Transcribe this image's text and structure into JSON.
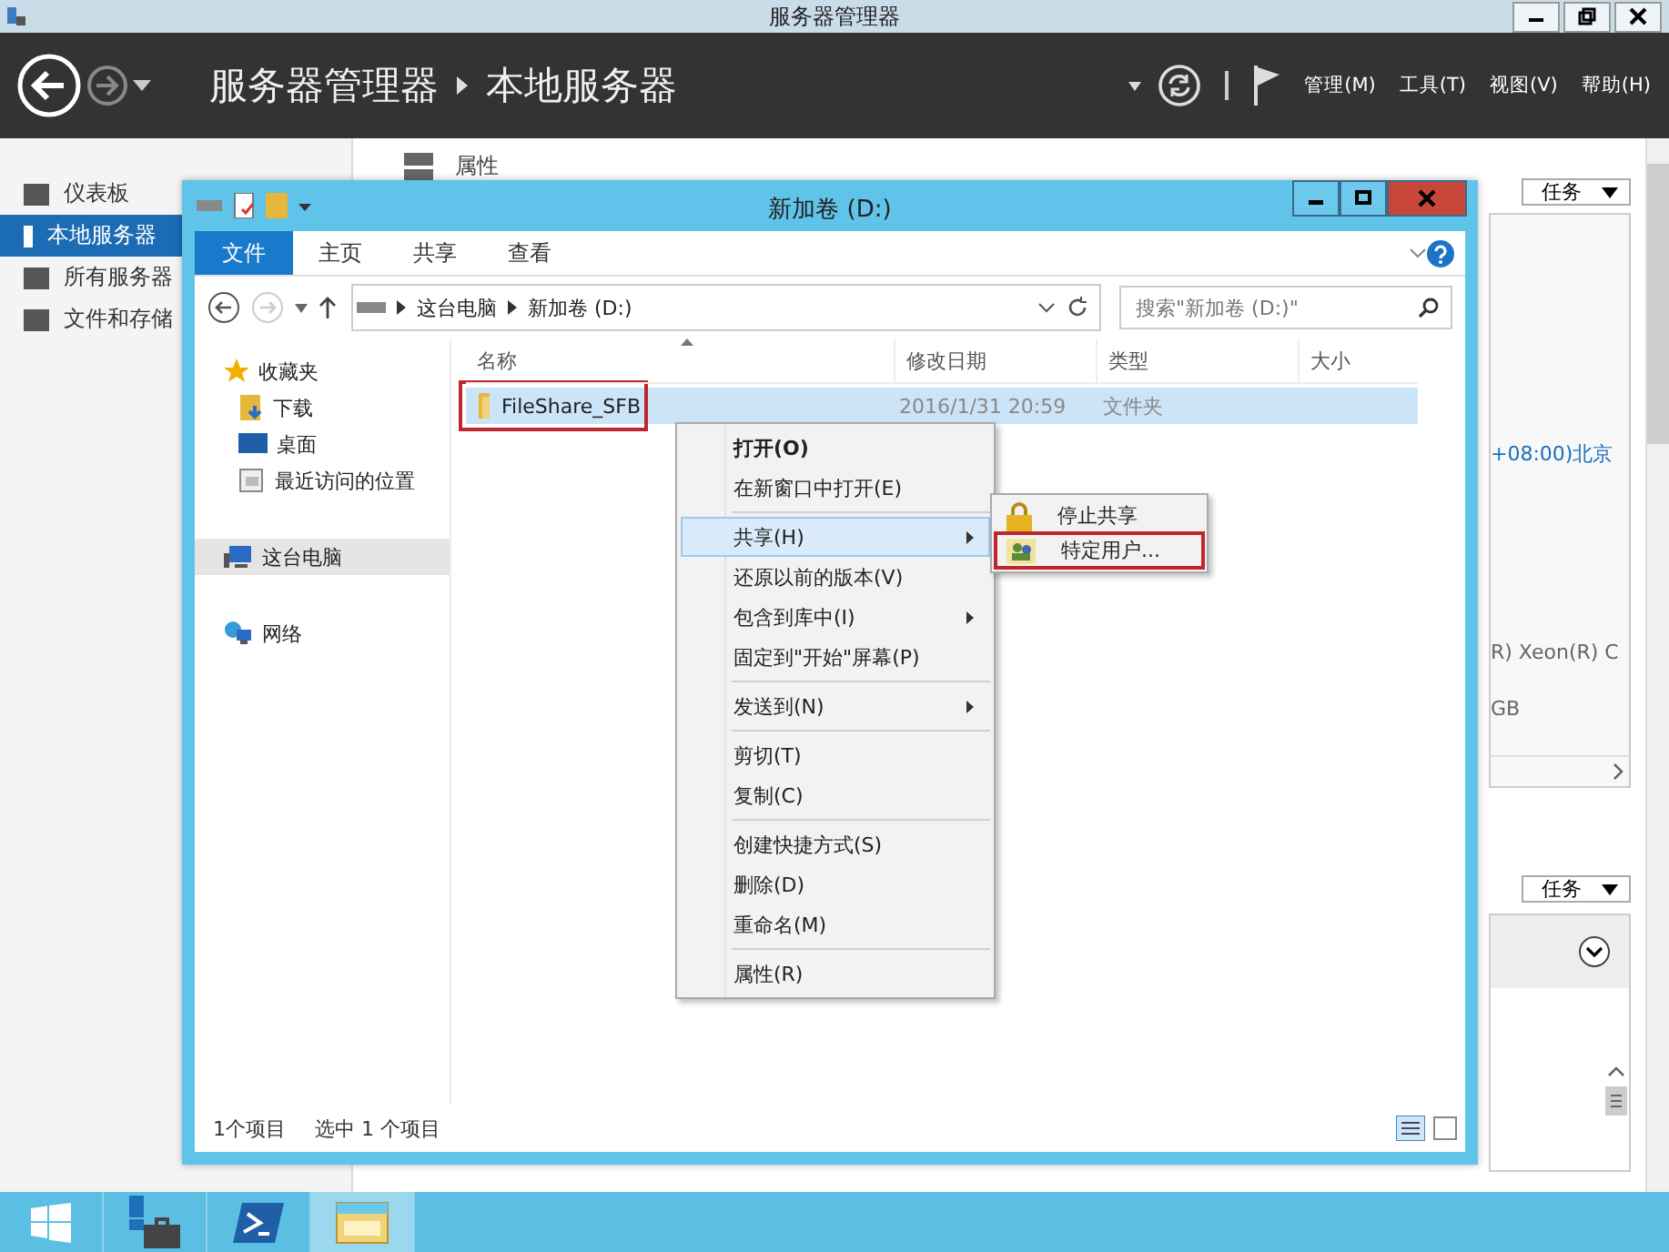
{
  "title_bar": {
    "title": "服务器管理器"
  },
  "header": {
    "breadcrumb": [
      "服务器管理器",
      "本地服务器"
    ],
    "menu": [
      "管理(M)",
      "工具(T)",
      "视图(V)",
      "帮助(H)"
    ]
  },
  "sidebar": {
    "items": [
      {
        "label": "仪表板",
        "selected": false
      },
      {
        "label": "本地服务器",
        "selected": true
      },
      {
        "label": "所有服务器",
        "selected": false
      },
      {
        "label": "文件和存储",
        "selected": false
      }
    ]
  },
  "content": {
    "heading": "属性",
    "task_buttons": [
      "任务",
      "任务"
    ],
    "fragments": [
      {
        "text": "+08:00)北京",
        "kind": "link"
      },
      {
        "text": "R) Xeon(R) C",
        "kind": "text"
      },
      {
        "text": "GB",
        "kind": "text"
      }
    ]
  },
  "explorer": {
    "title": "新加卷 (D:)",
    "ribbon_tabs": [
      {
        "label": "文件",
        "selected": true
      },
      {
        "label": "主页",
        "selected": false
      },
      {
        "label": "共享",
        "selected": false
      },
      {
        "label": "查看",
        "selected": false
      }
    ],
    "address": [
      "这台电脑",
      "新加卷 (D:)"
    ],
    "search": {
      "placeholder": "搜索\"新加卷 (D:)\""
    },
    "nav": [
      {
        "label": "收藏夹",
        "kind": "star",
        "selected": false,
        "children": [
          {
            "label": "下载",
            "kind": "download",
            "selected": false
          },
          {
            "label": "桌面",
            "kind": "desktop",
            "selected": false
          },
          {
            "label": "最近访问的位置",
            "kind": "recent",
            "selected": false
          }
        ]
      },
      {
        "label": "这台电脑",
        "kind": "computer",
        "selected": true
      },
      {
        "label": "网络",
        "kind": "network",
        "selected": false
      }
    ],
    "columns": [
      "名称",
      "修改日期",
      "类型",
      "大小"
    ],
    "rows": [
      {
        "name": "FileShare_SFB",
        "modified": "2016/1/31 20:59",
        "type": "文件夹",
        "selected": true,
        "highlighted": true
      }
    ],
    "status": [
      "1个项目",
      "选中 1 个项目"
    ]
  },
  "context_menu": {
    "items": [
      {
        "kind": "item",
        "label": "打开(O)",
        "bold": true,
        "submenu": false,
        "selected": false
      },
      {
        "kind": "item",
        "label": "在新窗口中打开(E)",
        "bold": false,
        "submenu": false,
        "selected": false
      },
      {
        "kind": "separator"
      },
      {
        "kind": "item",
        "label": "共享(H)",
        "bold": false,
        "submenu": true,
        "selected": true
      },
      {
        "kind": "item",
        "label": "还原以前的版本(V)",
        "bold": false,
        "submenu": false,
        "selected": false
      },
      {
        "kind": "item",
        "label": "包含到库中(I)",
        "bold": false,
        "submenu": true,
        "selected": false
      },
      {
        "kind": "item",
        "label": "固定到\"开始\"屏幕(P)",
        "bold": false,
        "submenu": false,
        "selected": false
      },
      {
        "kind": "separator"
      },
      {
        "kind": "item",
        "label": "发送到(N)",
        "bold": false,
        "submenu": true,
        "selected": false
      },
      {
        "kind": "separator"
      },
      {
        "kind": "item",
        "label": "剪切(T)",
        "bold": false,
        "submenu": false,
        "selected": false
      },
      {
        "kind": "item",
        "label": "复制(C)",
        "bold": false,
        "submenu": false,
        "selected": false
      },
      {
        "kind": "separator"
      },
      {
        "kind": "item",
        "label": "创建快捷方式(S)",
        "bold": false,
        "submenu": false,
        "selected": false
      },
      {
        "kind": "item",
        "label": "删除(D)",
        "bold": false,
        "submenu": false,
        "selected": false
      },
      {
        "kind": "item",
        "label": "重命名(M)",
        "bold": false,
        "submenu": false,
        "selected": false
      },
      {
        "kind": "separator"
      },
      {
        "kind": "item",
        "label": "属性(R)",
        "bold": false,
        "submenu": false,
        "selected": false
      }
    ]
  },
  "share_submenu": {
    "items": [
      {
        "label": "停止共享",
        "kind": "lock",
        "highlighted": false
      },
      {
        "label": "特定用户...",
        "kind": "users",
        "highlighted": true
      }
    ]
  },
  "taskbar": {
    "apps": [
      {
        "kind": "start",
        "selected": false
      },
      {
        "kind": "server_manager",
        "selected": false
      },
      {
        "kind": "powershell",
        "selected": false
      },
      {
        "kind": "explorer",
        "selected": true
      }
    ]
  }
}
